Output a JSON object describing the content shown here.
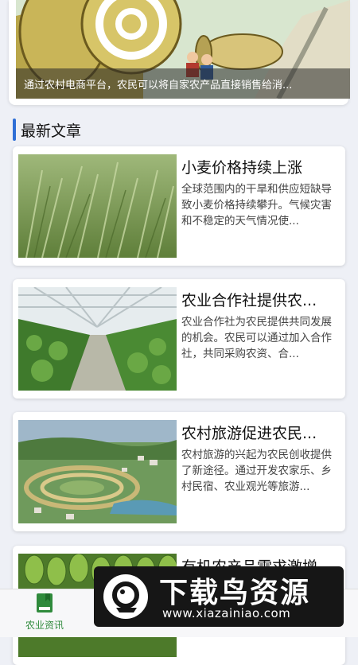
{
  "banner": {
    "caption": "通过农村电商平台，农民可以将自家农产品直接销售给消..."
  },
  "section": {
    "title": "最新文章"
  },
  "articles": [
    {
      "title": "小麦价格持续上涨",
      "summary": "全球范围内的干旱和供应短缺导致小麦价格持续攀升。气候灾害和不稳定的天气情况使..."
    },
    {
      "title": "农业合作社提供农...",
      "summary": "农业合作社为农民提供共同发展的机会。农民可以通过加入合作社，共同采购农资、合..."
    },
    {
      "title": "农村旅游促进农民...",
      "summary": "农村旅游的兴起为农民创收提供了新途径。通过开发农家乐、乡村民宿、农业观光等旅游..."
    },
    {
      "title": "有机农产品需求激增",
      "summary": ""
    }
  ],
  "bottom_nav": {
    "items": [
      {
        "label": "农业资讯",
        "icon": "book-icon",
        "active": true
      }
    ]
  },
  "watermark": {
    "title": "下载鸟资源",
    "url": "www.xiazainiao.com"
  },
  "colors": {
    "accent": "#2f6fd6",
    "nav_active": "#2f8a3c"
  }
}
